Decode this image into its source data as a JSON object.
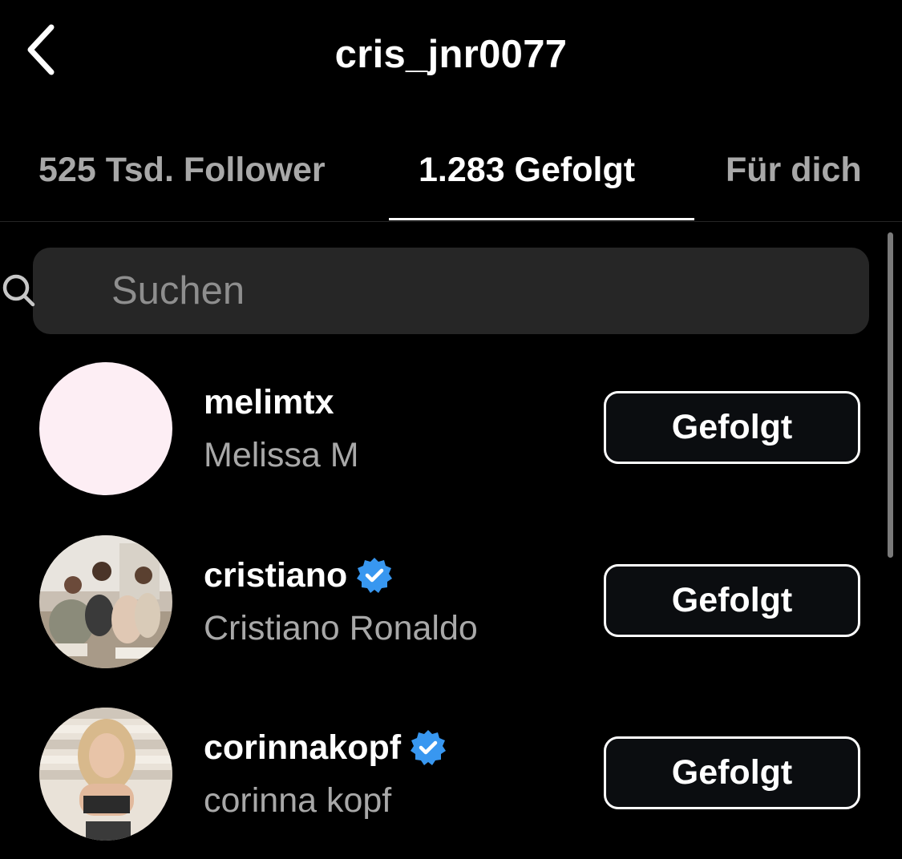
{
  "header": {
    "title": "cris_jnr0077",
    "back_icon": "chevron-left-icon"
  },
  "tabs": [
    {
      "label": "525 Tsd. Follower",
      "active": false
    },
    {
      "label": "1.283 Gefolgt",
      "active": true
    },
    {
      "label": "Für dich",
      "active": false
    }
  ],
  "search": {
    "placeholder": "Suchen",
    "value": "",
    "icon": "search-icon"
  },
  "colors": {
    "background": "#000000",
    "search_background": "#262626",
    "secondary_text": "#a8a8a8",
    "verified_badge": "#3897f0",
    "avatar_pink": "#fdeef4"
  },
  "accounts": [
    {
      "username": "melimtx",
      "full_name": "Melissa M",
      "verified": false,
      "button_label": "Gefolgt"
    },
    {
      "username": "cristiano",
      "full_name": "Cristiano Ronaldo",
      "verified": true,
      "button_label": "Gefolgt"
    },
    {
      "username": "corinnakopf",
      "full_name": "corinna kopf",
      "verified": true,
      "button_label": "Gefolgt"
    }
  ]
}
